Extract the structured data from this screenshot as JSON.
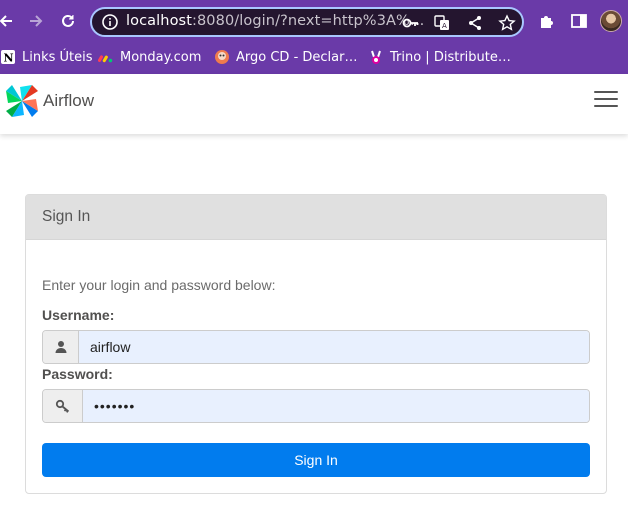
{
  "browser": {
    "url_host": "localhost",
    "url_rest": ":8080/login/?next=http%3A%…",
    "bookmarks": [
      {
        "label": "Links Úteis",
        "icon": "notion-icon"
      },
      {
        "label": "Monday.com",
        "icon": "monday-icon"
      },
      {
        "label": "Argo CD - Declar…",
        "icon": "argo-icon"
      },
      {
        "label": "Trino | Distribute…",
        "icon": "trino-icon"
      }
    ]
  },
  "app": {
    "brand": "Airflow"
  },
  "login": {
    "title": "Sign In",
    "hint": "Enter your login and password below:",
    "username_label": "Username:",
    "username_value": "airflow",
    "password_label": "Password:",
    "password_value": "•••••••",
    "submit_label": "Sign In"
  },
  "colors": {
    "browser_frame": "#6a3aa8",
    "primary_button": "#017cee",
    "panel_header": "#e0e0e0"
  }
}
